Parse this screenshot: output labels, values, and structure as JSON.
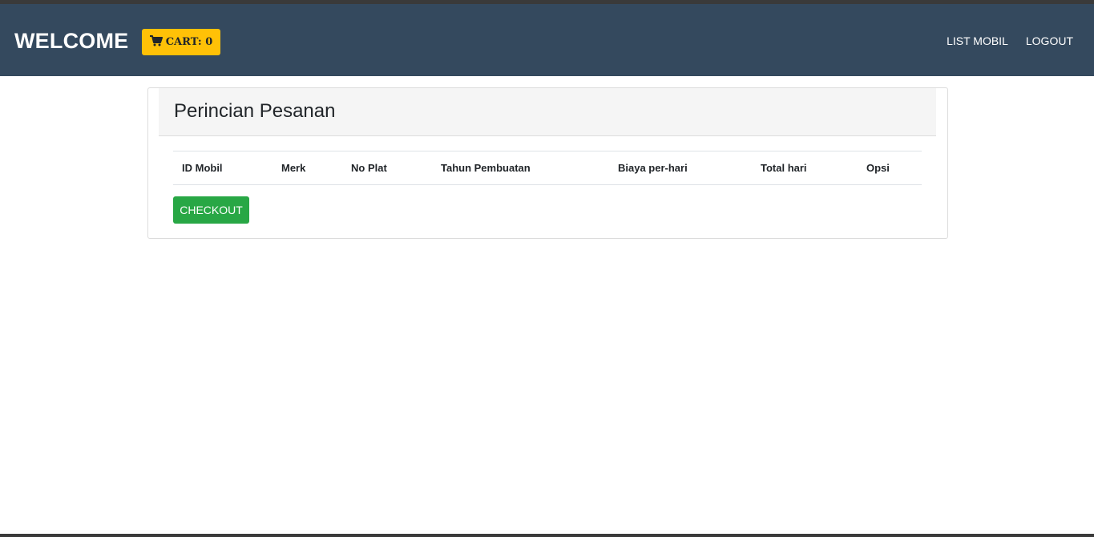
{
  "navbar": {
    "brand": "WELCOME",
    "cart_label": "CART: 0",
    "cart_icon": "shopping-cart-icon",
    "links": [
      "LIST MOBIL",
      "LOGOUT"
    ]
  },
  "card": {
    "title": "Perincian Pesanan",
    "table": {
      "columns": [
        "ID Mobil",
        "Merk",
        "No Plat",
        "Tahun Pembuatan",
        "Biaya per-hari",
        "Total hari",
        "Opsi"
      ],
      "rows": []
    },
    "checkout_label": "CHECKOUT"
  },
  "colors": {
    "navbar_bg": "#34495e",
    "cart_button": "#ffc107",
    "checkout_button": "#28a745"
  }
}
